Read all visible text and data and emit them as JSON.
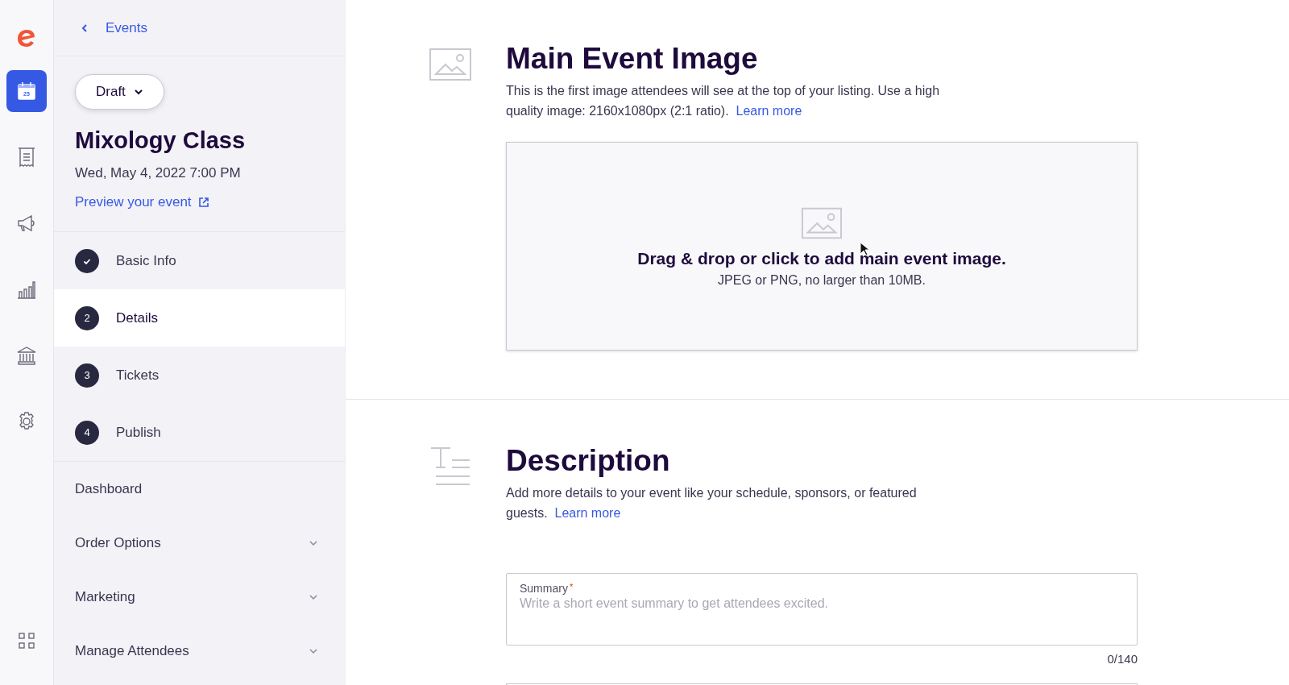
{
  "rail": {
    "items": [
      {
        "kind": "calendar",
        "day": "25",
        "selected": true
      },
      {
        "kind": "receipt",
        "selected": false
      },
      {
        "kind": "megaphone",
        "selected": false
      },
      {
        "kind": "chart",
        "selected": false
      },
      {
        "kind": "bank",
        "selected": false
      },
      {
        "kind": "settings",
        "selected": false
      }
    ],
    "bottom": {
      "kind": "apps"
    }
  },
  "sidebar": {
    "back_link": "Events",
    "status_button": "Draft",
    "event_title": "Mixology Class",
    "event_date": "Wed, May 4, 2022 7:00 PM",
    "preview_link": "Preview your event",
    "steps": [
      {
        "label": "Basic Info",
        "completed": true,
        "selected": false
      },
      {
        "label": "Details",
        "number": "2",
        "completed": false,
        "selected": true
      },
      {
        "label": "Tickets",
        "number": "3",
        "completed": false,
        "selected": false
      },
      {
        "label": "Publish",
        "number": "4",
        "completed": false,
        "selected": false
      }
    ],
    "nav": [
      {
        "label": "Dashboard",
        "expandable": false
      },
      {
        "label": "Order Options",
        "expandable": true
      },
      {
        "label": "Marketing",
        "expandable": true
      },
      {
        "label": "Manage Attendees",
        "expandable": true
      }
    ]
  },
  "main_image": {
    "heading": "Main Event Image",
    "description": "This is the first image attendees will see at the top of your listing. Use a high quality image: 2160x1080px (2:1 ratio).",
    "learn_more": "Learn more",
    "dropzone": {
      "title": "Drag & drop or click to add main event image.",
      "hint": "JPEG or PNG, no larger than 10MB."
    }
  },
  "description": {
    "heading": "Description",
    "text": "Add more details to your event like your schedule, sponsors, or featured guests.",
    "learn_more": "Learn more",
    "summary": {
      "label": "Summary",
      "required_mark": "*",
      "placeholder": "Write a short event summary to get attendees excited.",
      "counter": "0/140"
    }
  }
}
